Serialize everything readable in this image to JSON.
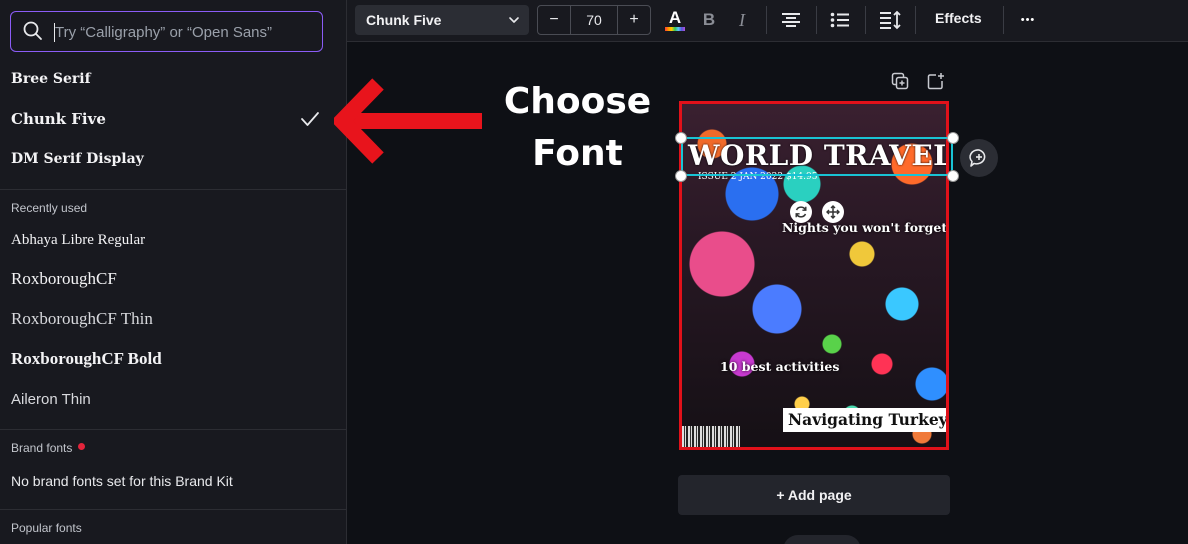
{
  "search": {
    "placeholder": "Try “Calligraphy” or “Open Sans”"
  },
  "fonts": {
    "top": [
      {
        "label": "Bree Serif"
      },
      {
        "label": "Chunk Five",
        "selected": true
      },
      {
        "label": "DM Serif Display"
      }
    ],
    "recently_used_title": "Recently used",
    "recent": [
      {
        "label": "Abhaya Libre Regular"
      },
      {
        "label": "RoxboroughCF"
      },
      {
        "label": "RoxboroughCF Thin"
      },
      {
        "label": "RoxboroughCF Bold"
      },
      {
        "label": "Aileron Thin"
      }
    ],
    "brand_title": "Brand fonts",
    "brand_note": "No brand fonts set for this Brand Kit",
    "popular_title": "Popular fonts"
  },
  "toolbar": {
    "font_name": "Chunk Five",
    "decrease": "−",
    "font_size": "70",
    "increase": "+",
    "text_color_glyph": "A",
    "bold_glyph": "B",
    "italic_glyph": "I",
    "effects": "Effects",
    "more_glyph": "•••"
  },
  "annotation": {
    "line1": "Choose",
    "line2": "Font"
  },
  "design": {
    "title": "WORLD TRAVEL",
    "issue": "ISSUE 2 JAN 2022 $14.95",
    "nights": "Nights you won't forget",
    "best": "10 best activities",
    "navigating": "Navigating Turkey"
  },
  "add_page": "+ Add page",
  "colors": {
    "accent_purple": "#8b5cf6",
    "selection_cyan": "#19c3d4",
    "page_border_red": "#e1111a",
    "arrow_red": "#e8141c"
  },
  "icons": [
    "search-icon",
    "check-icon",
    "chevron-down-icon",
    "text-color-icon",
    "bold-icon",
    "italic-icon",
    "align-center-icon",
    "list-icon",
    "spacing-icon",
    "more-icon",
    "duplicate-page-icon",
    "add-page-icon",
    "rotate-icon",
    "move-icon",
    "comment-add-icon"
  ]
}
